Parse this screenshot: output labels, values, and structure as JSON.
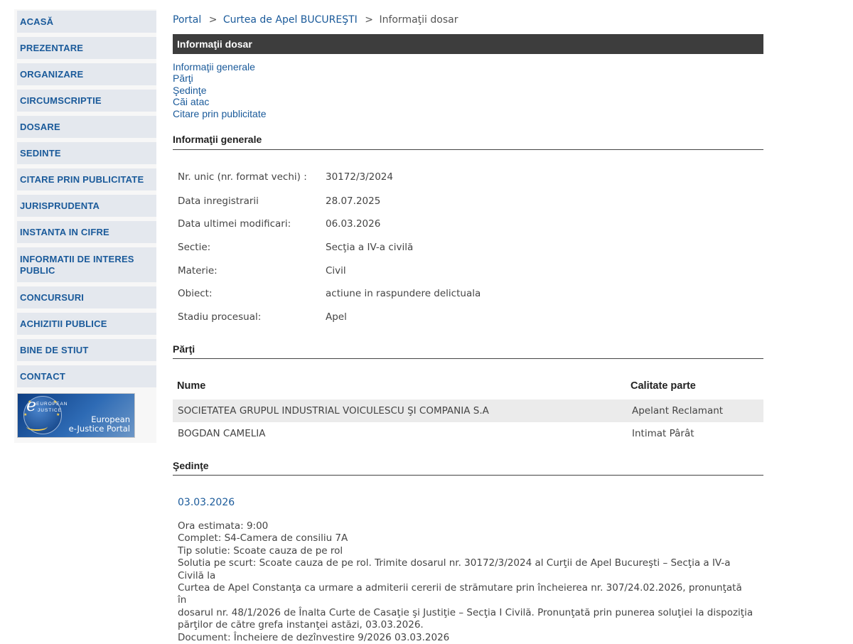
{
  "sidebar": {
    "items": [
      {
        "label": "ACASĂ"
      },
      {
        "label": "PREZENTARE"
      },
      {
        "label": "ORGANIZARE"
      },
      {
        "label": "CIRCUMSCRIPTIE"
      },
      {
        "label": "DOSARE"
      },
      {
        "label": "SEDINTE"
      },
      {
        "label": "CITARE PRIN PUBLICITATE"
      },
      {
        "label": "JURISPRUDENTA"
      },
      {
        "label": "INSTANTA IN CIFRE"
      },
      {
        "label": "INFORMATII DE INTERES PUBLIC"
      },
      {
        "label": "CONCURSURI"
      },
      {
        "label": "ACHIZITII PUBLICE"
      },
      {
        "label": "BINE DE STIUT"
      },
      {
        "label": "CONTACT"
      }
    ],
    "ejustice": {
      "eu_top": "EUROPEAN",
      "eu_bottom": "JUSTICE",
      "line1": "European",
      "line2": "e-Justice Portal"
    }
  },
  "breadcrumb": {
    "portal": "Portal",
    "sep": ">",
    "court": "Curtea de Apel BUCUREŞTI",
    "current": "Informaţii dosar"
  },
  "title": "Informaţii dosar",
  "anchors": [
    "Informaţii generale",
    "Părţi",
    "Şedinţe",
    "Căi atac",
    "Citare prin publicitate"
  ],
  "general": {
    "heading": "Informaţii generale",
    "rows": [
      {
        "label": "Nr. unic (nr. format vechi) :",
        "value": "30172/3/2024"
      },
      {
        "label": "Data inregistrarii",
        "value": "28.07.2025"
      },
      {
        "label": "Data ultimei modificari:",
        "value": "06.03.2026"
      },
      {
        "label": "Sectie:",
        "value": "Secţia a IV-a civilă"
      },
      {
        "label": "Materie:",
        "value": "Civil"
      },
      {
        "label": "Obiect:",
        "value": "actiune in raspundere delictuala"
      },
      {
        "label": "Stadiu procesual:",
        "value": "Apel"
      }
    ]
  },
  "parti": {
    "heading": "Părţi",
    "col_name": "Nume",
    "col_role": "Calitate parte",
    "rows": [
      {
        "name": "SOCIETATEA GRUPUL INDUSTRIAL VOICULESCU ŞI COMPANIA S.A",
        "role": "Apelant Reclamant"
      },
      {
        "name": "BOGDAN CAMELIA",
        "role": "Intimat Pârât"
      }
    ]
  },
  "sedinte": {
    "heading": "Şedinţe",
    "date": "03.03.2026",
    "lines": [
      "Ora estimata: 9:00",
      "Complet: S4-Camera de consiliu 7A",
      "Tip solutie: Scoate cauza de pe rol",
      "Solutia pe scurt: Scoate cauza de pe rol. Trimite dosarul nr. 30172/3/2024 al Curţii de Apel Bucureşti – Secţia a IV-a Civilă la",
      "Curtea de Apel Constanţa ca urmare a admiterii cererii de strămutare prin încheierea nr. 307/24.02.2026, pronunţată în",
      "dosarul nr. 48/1/2026 de Înalta Curte de Casaţie şi Justiţie – Secţia I Civilă. Pronunţată prin punerea soluţiei la dispoziţia",
      "părţilor de către grefa instanţei astăzi, 03.03.2026.",
      "Document: Încheiere de dezînvestire  9/2026  03.03.2026"
    ]
  },
  "colors": {
    "link": "#1a5a9a",
    "menu_bg": "#e4e8ee",
    "title_bar": "#3d3d3d",
    "row_shade": "#ebebeb"
  }
}
